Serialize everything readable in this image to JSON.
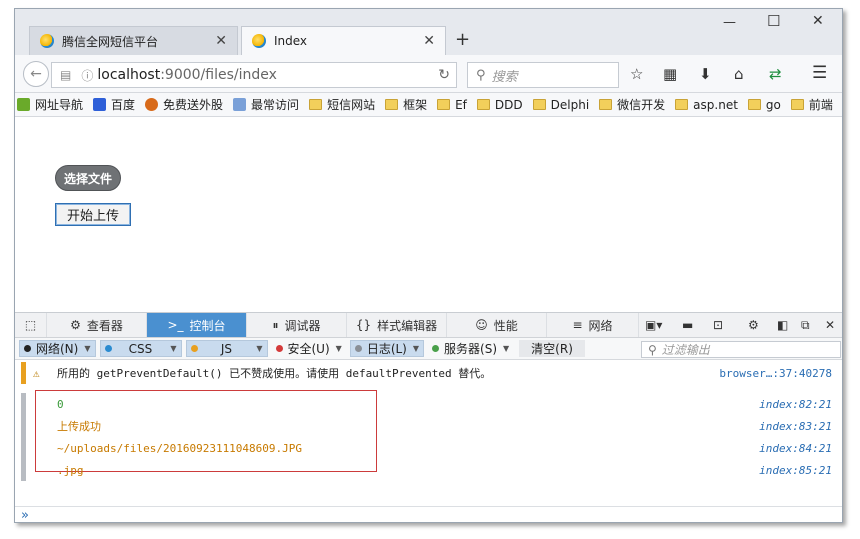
{
  "tabs": [
    {
      "label": "腾信全网短信平台",
      "active": false
    },
    {
      "label": "Index",
      "active": true
    }
  ],
  "nav": {
    "url_host": "localhost",
    "url_path": ":9000/files/index",
    "search_placeholder": "搜索"
  },
  "bookmarks": [
    {
      "label": "网址导航",
      "icon": "hao-icon"
    },
    {
      "label": "百度",
      "icon": "baidu-icon"
    },
    {
      "label": "免费送外股",
      "icon": "gift-icon"
    },
    {
      "label": "最常访问",
      "icon": "frequent-icon"
    },
    {
      "label": "短信网站",
      "icon": "folder-icon"
    },
    {
      "label": "框架",
      "icon": "folder-icon"
    },
    {
      "label": "Ef",
      "icon": "folder-icon"
    },
    {
      "label": "DDD",
      "icon": "folder-icon"
    },
    {
      "label": "Delphi",
      "icon": "folder-icon"
    },
    {
      "label": "微信开发",
      "icon": "folder-icon"
    },
    {
      "label": "asp.net",
      "icon": "folder-icon"
    },
    {
      "label": "go",
      "icon": "folder-icon"
    },
    {
      "label": "前端",
      "icon": "folder-icon"
    }
  ],
  "page": {
    "choose_file_label": "选择文件",
    "upload_label": "开始上传"
  },
  "devtools": {
    "tabs": [
      {
        "label": "查看器",
        "icon": "inspector-icon"
      },
      {
        "label": "控制台",
        "icon": "console-icon",
        "active": true
      },
      {
        "label": "调试器",
        "icon": "debugger-icon"
      },
      {
        "label": "样式编辑器",
        "icon": "style-editor-icon"
      },
      {
        "label": "性能",
        "icon": "performance-icon"
      },
      {
        "label": "网络",
        "icon": "network-icon"
      }
    ],
    "filters": [
      {
        "label": "网络(N)",
        "color": "#222222"
      },
      {
        "label": "CSS",
        "color": "#2a8bd0"
      },
      {
        "label": "JS",
        "color": "#e8a020"
      },
      {
        "label": "安全(U)",
        "color": "#d43b3b"
      },
      {
        "label": "日志(L)",
        "color": "#8a8f96"
      },
      {
        "label": "服务器(S)",
        "color": "#4aa04a"
      }
    ],
    "clear_label": "清空(R)",
    "filter_placeholder": "过滤输出",
    "messages": [
      {
        "text": "所用的 getPreventDefault() 已不赞成使用。请使用 defaultPrevented 替代。",
        "source": "browser…:37:40278",
        "type": "warning"
      },
      {
        "text": "0",
        "source": "index:82:21",
        "type": "log-number"
      },
      {
        "text": "上传成功",
        "source": "index:83:21",
        "type": "log-string"
      },
      {
        "text": "~/uploads/files/20160923111048609.JPG",
        "source": "index:84:21",
        "type": "log-string"
      },
      {
        "text": ".jpg",
        "source": "index:85:21",
        "type": "log-string"
      }
    ],
    "prompt_symbol": "»"
  },
  "colors": {
    "accent": "#4a90d0",
    "warning_gutter": "#e8a020",
    "log_string": "#c77a00",
    "log_number": "#3a9a3a",
    "source_link": "#2a6db3",
    "highlight_box": "#cc3b3b"
  }
}
